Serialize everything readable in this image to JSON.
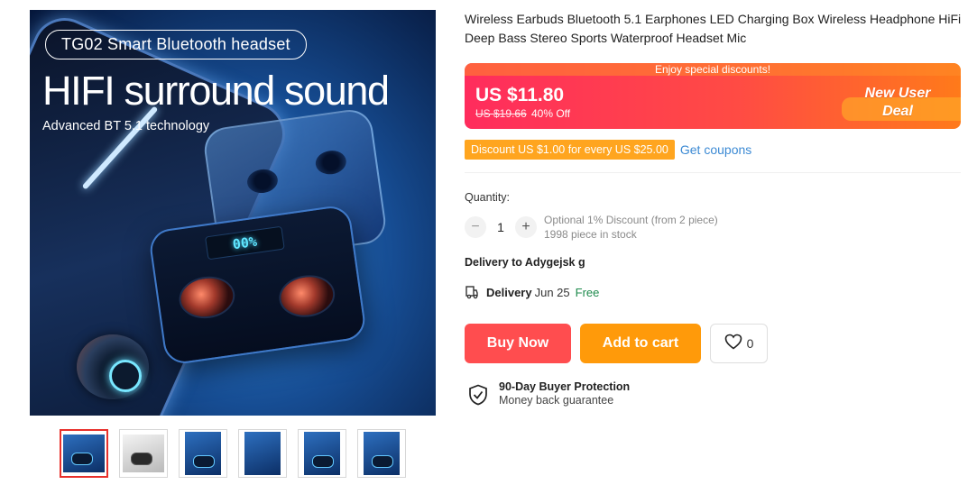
{
  "gallery": {
    "main_image": {
      "tag_text": "TG02 Smart Bluetooth headset",
      "headline": "HIFI surround sound",
      "subline": "Advanced BT 5.1 technology",
      "display_text": "00%"
    },
    "thumbnail_count": 6,
    "active_thumbnail": 1
  },
  "product": {
    "title": "Wireless Earbuds Bluetooth 5.1 Earphones LED Charging Box Wireless Headphone HiFi Deep Bass Stereo Sports Waterproof Headset Mic"
  },
  "promo": {
    "banner_text": "Enjoy special discounts!",
    "price_now": "US $11.80",
    "price_was": "US $19.66",
    "discount": "40% Off",
    "badge_line1": "New User",
    "badge_line2": "Deal",
    "colors": {
      "start": "#ff2c5d",
      "end": "#ff7a1a"
    }
  },
  "coupon": {
    "tag_text": "Discount US $1.00 for every US $25.00",
    "link_text": "Get coupons"
  },
  "quantity": {
    "label": "Quantity:",
    "minus": "−",
    "value": "1",
    "plus": "+",
    "note_line1": "Optional 1% Discount (from 2 piece)",
    "note_line2": "1998 piece in stock"
  },
  "delivery": {
    "to_text": "Delivery to Adygejsk g",
    "label": "Delivery",
    "date": "Jun 25",
    "cost": "Free"
  },
  "actions": {
    "buy_now": "Buy Now",
    "add_to_cart": "Add to cart",
    "wishlist_count": "0",
    "colors": {
      "buy": "#ff4d4f",
      "cart": "#ff9a0a"
    }
  },
  "protection": {
    "title": "90-Day Buyer Protection",
    "subtitle": "Money back guarantee"
  }
}
